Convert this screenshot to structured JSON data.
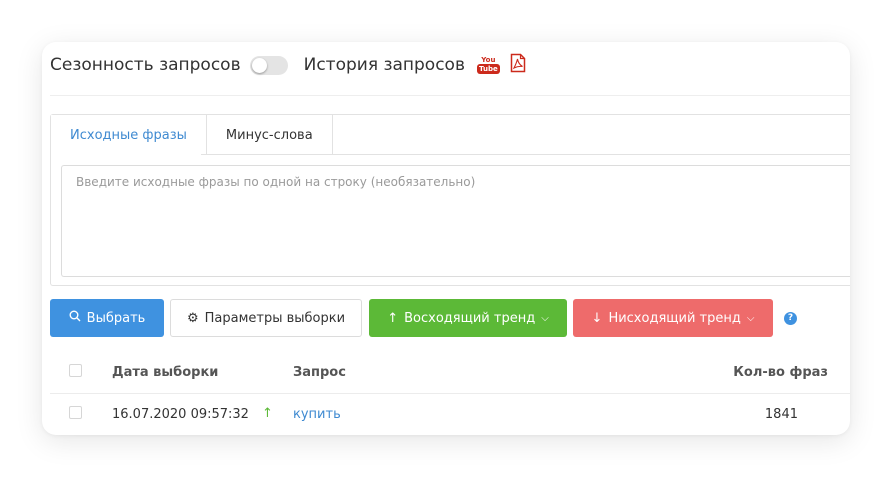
{
  "header": {
    "seasonality_label": "Сезонность запросов",
    "history_label": "История запросов",
    "toggle_on": false,
    "icons": [
      "youtube-icon",
      "pdf-icon"
    ]
  },
  "tabs": [
    {
      "label": "Исходные фразы",
      "active": true
    },
    {
      "label": "Минус-слова",
      "active": false
    }
  ],
  "textarea": {
    "placeholder": "Введите исходные фразы по одной на строку (необязательно)"
  },
  "toolbar": {
    "select_label": "Выбрать",
    "params_label": "Параметры выборки",
    "up_trend_label": "Восходящий тренд",
    "down_trend_label": "Нисходящий тренд",
    "help_label": "?"
  },
  "colors": {
    "primary": "#3f92e0",
    "success": "#5cb937",
    "danger": "#ee6b6b",
    "link": "#3f8ad1",
    "icon_red": "#cc2a1c"
  },
  "table": {
    "columns": {
      "date": "Дата выборки",
      "query": "Запрос",
      "count": "Кол-во фраз"
    },
    "rows": [
      {
        "date": "16.07.2020 09:57:32",
        "trend": "up",
        "query": "купить",
        "count": "1841"
      }
    ]
  }
}
